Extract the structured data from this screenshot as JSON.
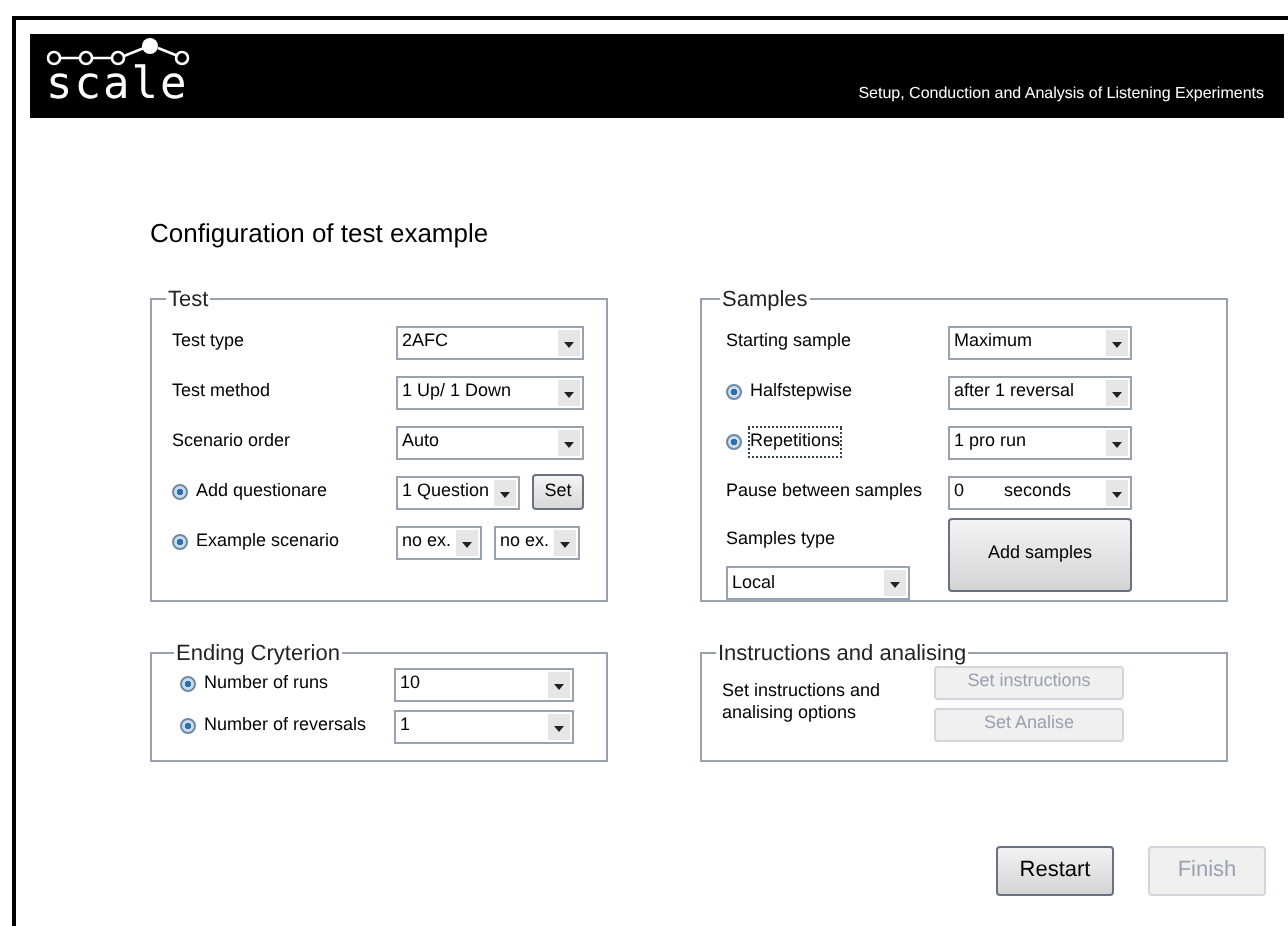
{
  "header": {
    "logo": "scale",
    "tagline": "Setup, Conduction and Analysis of Listening Experiments"
  },
  "title": "Configuration of test example",
  "test": {
    "title": "Test",
    "rows": [
      {
        "kind": "plain",
        "label": "Test type",
        "selects": [
          "2AFC"
        ]
      },
      {
        "kind": "plain",
        "label": "Test method",
        "selects": [
          "1 Up/ 1 Down"
        ]
      },
      {
        "kind": "plain",
        "label": "Scenario order",
        "selects": [
          "Auto"
        ]
      },
      {
        "kind": "radio",
        "checked": true,
        "label": "Add questionare",
        "selects": [
          "1 Question"
        ],
        "button": "Set"
      },
      {
        "kind": "radio",
        "checked": true,
        "label": "Example scenario",
        "selects": [
          "no ex.",
          "no ex."
        ]
      }
    ]
  },
  "samples": {
    "title": "Samples",
    "rows": [
      {
        "kind": "plain",
        "label": "Starting sample",
        "selects": [
          "Maximum"
        ]
      },
      {
        "kind": "radio",
        "checked": true,
        "focused": false,
        "label": "Halfstepwise",
        "selects": [
          "after 1 reversal"
        ]
      },
      {
        "kind": "radio",
        "checked": true,
        "focused": true,
        "label": "Repetitions",
        "selects": [
          "1 pro run"
        ]
      },
      {
        "kind": "plain",
        "label": "Pause between samples",
        "selects": [
          "0"
        ],
        "unit": "seconds"
      }
    ],
    "type_label": "Samples type",
    "type_value": "Local",
    "add_button": "Add samples"
  },
  "ending": {
    "title": "Ending Cryterion",
    "rows": [
      {
        "kind": "radio",
        "checked": true,
        "label": "Number of runs",
        "selects": [
          "10"
        ]
      },
      {
        "kind": "radio",
        "checked": true,
        "label": "Number of reversals",
        "selects": [
          "1"
        ]
      }
    ]
  },
  "instructions": {
    "title": "Instructions and analising",
    "text": "Set instructions and analising options",
    "buttons": [
      {
        "label": "Set instructions",
        "disabled": true
      },
      {
        "label": "Set Analise",
        "disabled": true
      }
    ]
  },
  "footer": [
    {
      "label": "Restart",
      "disabled": false
    },
    {
      "label": "Finish",
      "disabled": true
    }
  ]
}
